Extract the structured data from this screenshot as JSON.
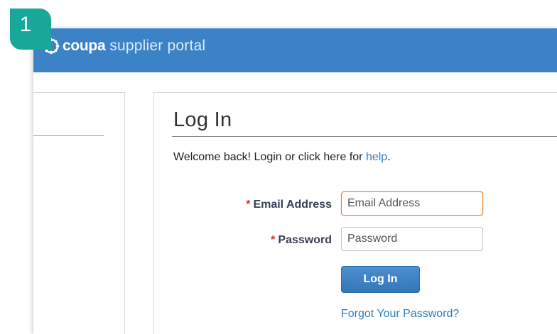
{
  "step_badge": {
    "number": "1"
  },
  "header": {
    "brand": "coupa",
    "product": "supplier portal",
    "icon": "coupa-flower-icon",
    "colors": {
      "bar": "#3c82c6",
      "text": "#ffffff"
    }
  },
  "login": {
    "title": "Log In",
    "welcome_text": "Welcome back! Login or click here for ",
    "help_link": "help",
    "welcome_suffix": ".",
    "required_mark": "*",
    "email": {
      "label": "Email Address",
      "placeholder": "Email Address",
      "value": ""
    },
    "password": {
      "label": "Password",
      "placeholder": "Password",
      "value": ""
    },
    "submit_label": "Log In",
    "forgot_link": "Forgot Your Password?"
  },
  "colors": {
    "accent": "#18a89a",
    "link": "#2f7fc1",
    "required": "#d2302c",
    "focus": "#ec7a2a",
    "button": "#3676b8"
  }
}
